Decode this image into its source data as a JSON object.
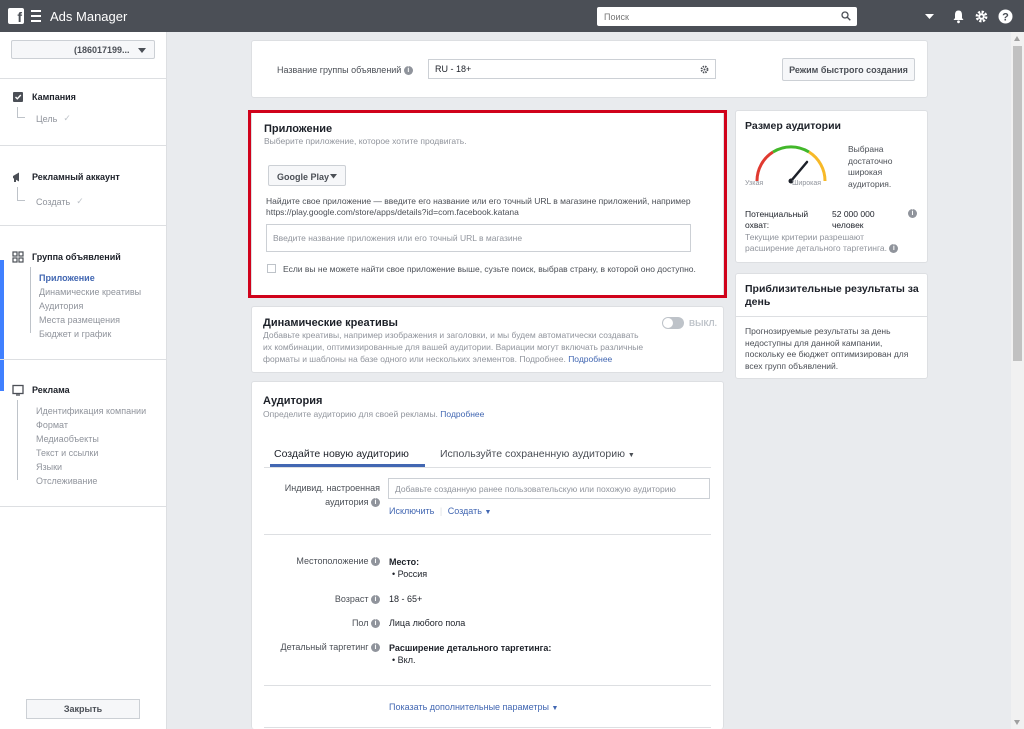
{
  "topbar": {
    "title": "Ads Manager",
    "search_placeholder": "Поиск"
  },
  "sidebar": {
    "account": "(186017199...",
    "campaign": {
      "label": "Кампания",
      "sub": "Цель"
    },
    "ad_account": {
      "label": "Рекламный аккаунт",
      "sub": "Создать"
    },
    "adset": {
      "label": "Группа объявлений",
      "items": [
        "Приложение",
        "Динамические креативы",
        "Аудитория",
        "Места размещения",
        "Бюджет и график"
      ]
    },
    "ad": {
      "label": "Реклама",
      "items": [
        "Идентификация компании",
        "Формат",
        "Медиаобъекты",
        "Текст и ссылки",
        "Языки",
        "Отслеживание"
      ]
    },
    "close_label": "Закрыть"
  },
  "adset_name": {
    "label": "Название группы объявлений",
    "value": "RU - 18+",
    "quick_create_label": "Режим быстрого создания"
  },
  "app_section": {
    "title": "Приложение",
    "subtitle": "Выберите приложение, которое хотите продвигать.",
    "store_label": "Google Play",
    "help_line1": "Найдите свое приложение — введите его название или его точный URL в магазине приложений, например",
    "help_line2": "https://play.google.com/store/apps/details?id=com.facebook.katana",
    "input_placeholder": "Введите название приложения или его точный URL в магазине",
    "checkbox_label": "Если вы не можете найти свое приложение выше, сузьте поиск, выбрав страну, в которой оно доступно."
  },
  "dynamic": {
    "title": "Динамические креативы",
    "toggle_label": "ВЫКЛ.",
    "line1": "Добавьте креативы, например изображения и заголовки, и мы будем автоматически создавать",
    "line2": "их комбинации, оптимизированные для вашей аудитории. Вариации могут включать различные",
    "line3": "форматы и шаблоны на базе одного или нескольких элементов. Подробнее.",
    "link": "Подробнее"
  },
  "audience": {
    "title": "Аудитория",
    "subtitle": "Определите аудиторию для своей рекламы.",
    "subtitle_link": "Подробнее",
    "tab_new": "Создайте новую аудиторию",
    "tab_saved": "Используйте сохраненную аудиторию",
    "custom_label_1": "Индивид. настроенная",
    "custom_label_2": "аудитория",
    "custom_placeholder": "Добавьте созданную ранее пользовательскую или похожую аудиторию",
    "exclude": "Исключить",
    "create": "Создать",
    "location_label": "Местоположение",
    "location_head": "Место:",
    "location_value": "Россия",
    "age_label": "Возраст",
    "age_value": "18 - 65+",
    "gender_label": "Пол",
    "gender_value": "Лица любого пола",
    "detailed_label": "Детальный таргетинг",
    "detailed_head": "Расширение детального таргетинга:",
    "detailed_value": "Вкл.",
    "more_options": "Показать дополнительные параметры"
  },
  "audience_size": {
    "title": "Размер аудитории",
    "gauge_narrow": "Узкая",
    "gauge_wide": "Широкая",
    "desc_lines": [
      "Выбрана",
      "достаточно",
      "широкая",
      "аудитория."
    ],
    "reach_label_1": "Потенциальный",
    "reach_label_2": "охват:",
    "reach_value_1": "52 000 000",
    "reach_value_2": "человек",
    "note_1": "Текущие критерии разрешают",
    "note_2": "расширение детального таргетинга."
  },
  "estimates": {
    "title_1": "Приблизительные результаты за",
    "title_2": "день",
    "lines": [
      "Прогнозируемые результаты за день",
      "недоступны для данной кампании,",
      "поскольку ее бюджет оптимизирован для",
      "всех групп объявлений."
    ]
  }
}
